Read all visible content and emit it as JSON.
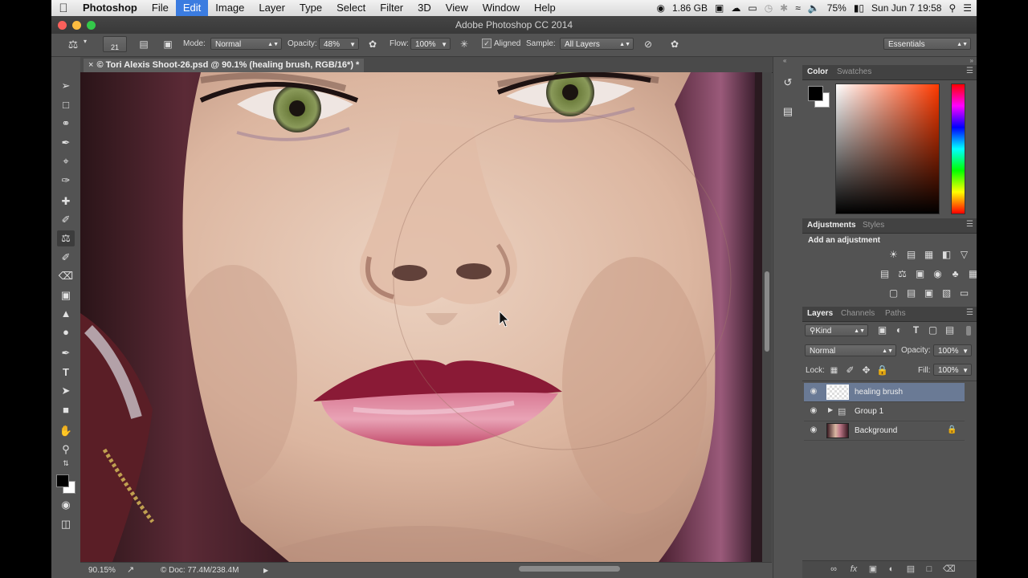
{
  "menubar": {
    "apple_icon": "apple-icon",
    "items": [
      "Photoshop",
      "File",
      "Edit",
      "Image",
      "Layer",
      "Type",
      "Select",
      "Filter",
      "3D",
      "View",
      "Window",
      "Help"
    ],
    "active_item": "Edit",
    "status": {
      "memory": "1.86 GB",
      "battery": "75%",
      "clock": "Sun Jun 7  19:58"
    }
  },
  "window": {
    "title": "Adobe Photoshop CC 2014",
    "traffic_colors": [
      "#fc605b",
      "#fdbc40",
      "#34c84a"
    ]
  },
  "options": {
    "brush_size": "21",
    "mode_label": "Mode:",
    "mode_value": "Normal",
    "opacity_label": "Opacity:",
    "opacity_value": "48%",
    "flow_label": "Flow:",
    "flow_value": "100%",
    "aligned_label": "Aligned",
    "aligned_checked": true,
    "sample_label": "Sample:",
    "sample_value": "All Layers",
    "workspace": "Essentials"
  },
  "document": {
    "tab_title": "© Tori Alexis Shoot-26.psd @ 90.1% (healing brush, RGB/16*) *"
  },
  "statusbar": {
    "zoom": "90.15%",
    "doc_info": "© Doc: 77.4M/238.4M"
  },
  "color_panel": {
    "tabs": [
      "Color",
      "Swatches"
    ],
    "foreground": "#000000",
    "background": "#ffffff",
    "hue_color": "#ff3a00"
  },
  "adjustments_panel": {
    "tabs": [
      "Adjustments",
      "Styles"
    ],
    "heading": "Add an adjustment"
  },
  "layers_panel": {
    "tabs": [
      "Layers",
      "Channels",
      "Paths"
    ],
    "filter_label": "Kind",
    "blend_mode": "Normal",
    "opacity_label": "Opacity:",
    "opacity_value": "100%",
    "lock_label": "Lock:",
    "fill_label": "Fill:",
    "fill_value": "100%",
    "layers": [
      {
        "name": "healing brush",
        "selected": true
      },
      {
        "name": "Group 1",
        "selected": false
      },
      {
        "name": "Background",
        "selected": false
      }
    ]
  }
}
